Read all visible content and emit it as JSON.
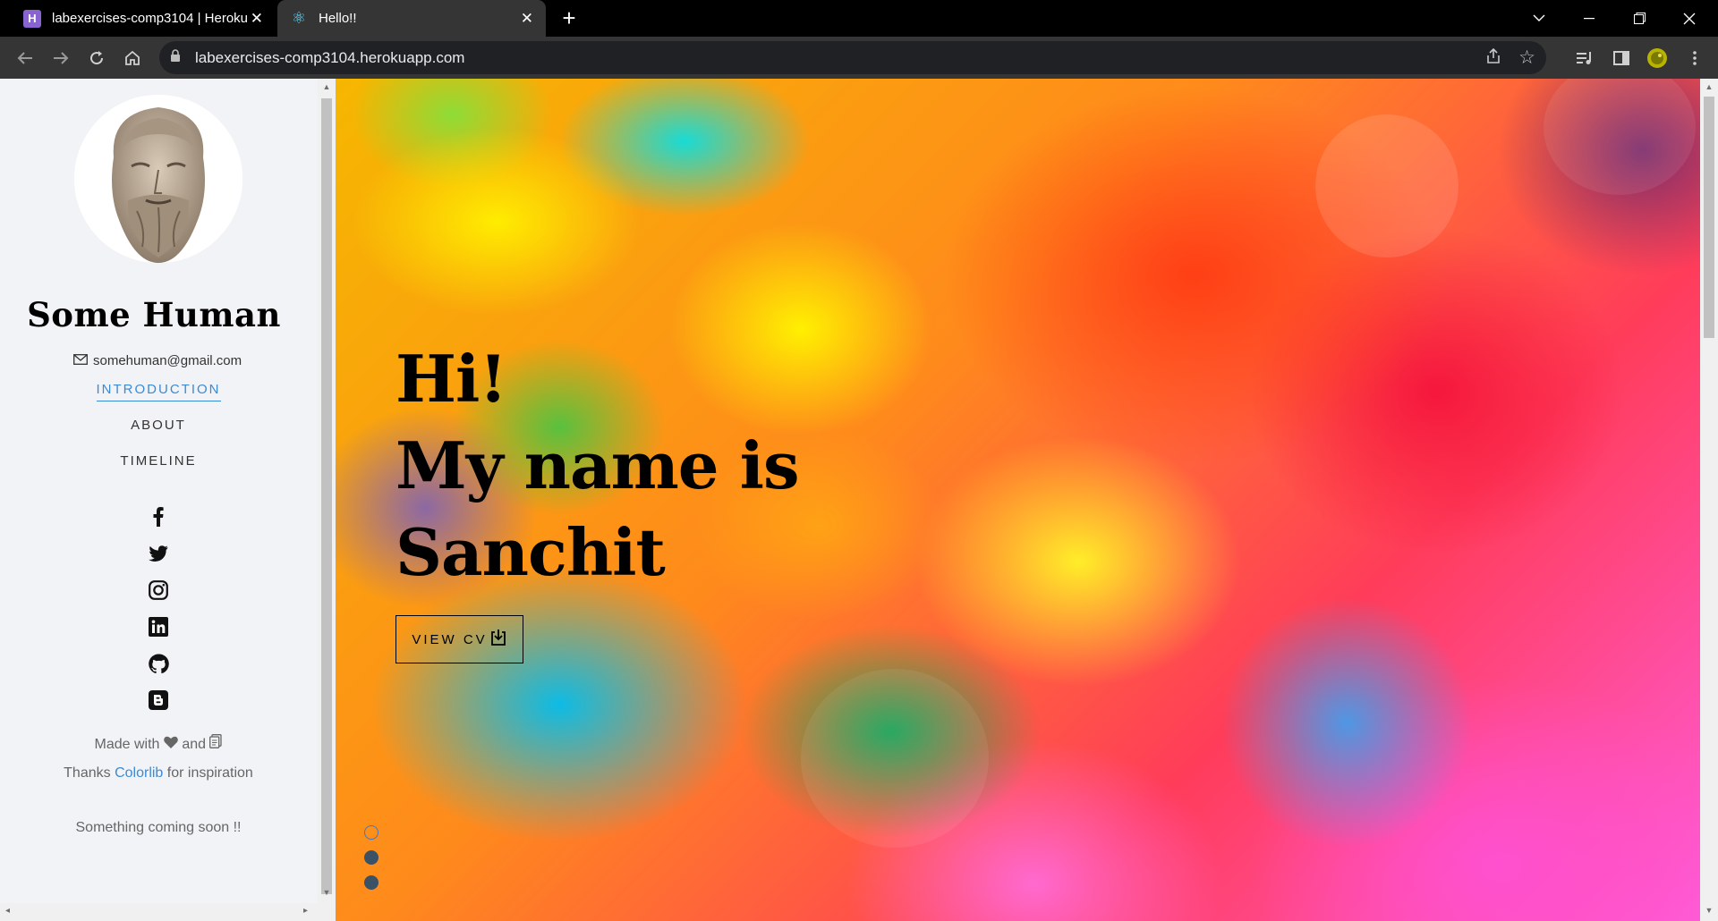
{
  "browser": {
    "tabs": [
      {
        "title": "labexercises-comp3104 | Heroku",
        "favicon": "heroku-icon",
        "active": false
      },
      {
        "title": "Hello!!",
        "favicon": "react-icon",
        "active": true
      }
    ],
    "new_tab_icon": "plus-icon",
    "url": "labexercises-comp3104.herokuapp.com",
    "toolbar_icons": [
      "back-icon",
      "forward-icon",
      "reload-icon",
      "home-icon",
      "lock-icon",
      "share-icon",
      "star-icon",
      "media-icon",
      "sidepanel-icon",
      "profile-icon",
      "menu-icon"
    ],
    "window_controls": [
      "tab-search-icon",
      "minimize-icon",
      "restore-icon",
      "close-icon"
    ]
  },
  "sidebar": {
    "name": "Some Human",
    "email": "somehuman@gmail.com",
    "nav": [
      {
        "label": "INTRODUCTION",
        "active": true
      },
      {
        "label": "ABOUT",
        "active": false
      },
      {
        "label": "TIMELINE",
        "active": false
      }
    ],
    "social_icons": [
      "facebook-icon",
      "twitter-icon",
      "instagram-icon",
      "linkedin-icon",
      "github-icon",
      "blogger-icon"
    ],
    "made_with": "Made with",
    "and": "and",
    "thanks": "Thanks",
    "colorlib": "Colorlib",
    "for_inspiration": "for inspiration",
    "coming_soon": "Something coming soon !!"
  },
  "hero": {
    "line1": "Hi!",
    "line2": "My name is",
    "line3": "Sanchit",
    "button": "VIEW CV",
    "slides": 3,
    "active_slide": 1
  },
  "colors": {
    "accent": "#3b8bd4",
    "sidebar_bg": "#f2f3f7",
    "chrome_dark": "#353535"
  }
}
